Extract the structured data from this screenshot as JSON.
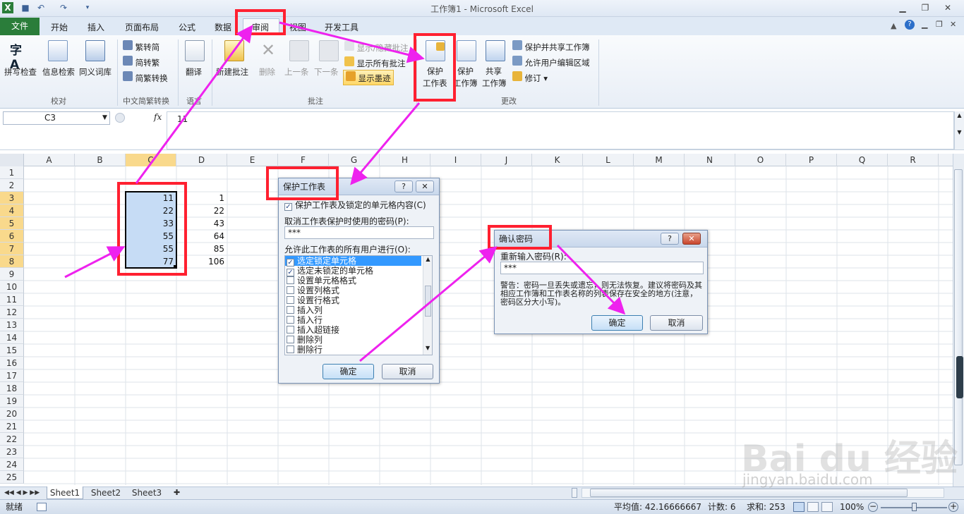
{
  "window": {
    "title": "工作簿1 - Microsoft Excel"
  },
  "tabs": {
    "file": "文件",
    "items": [
      "开始",
      "插入",
      "页面布局",
      "公式",
      "数据",
      "审阅",
      "视图",
      "开发工具"
    ],
    "active": "审阅"
  },
  "ribbon": {
    "proof": {
      "spell": "拼写检查",
      "research": "信息检索",
      "thesaurus": "同义词库",
      "group": "校对"
    },
    "chinese": {
      "t2s": "繁转简",
      "s2t": "简转繁",
      "convert": "简繁转换",
      "group": "中文简繁转换"
    },
    "language": {
      "translate": "翻译",
      "group": "语言"
    },
    "comments": {
      "new": "新建批注",
      "delete": "删除",
      "prev": "上一条",
      "next": "下一条",
      "showhide": "显示/隐藏批注",
      "showall": "显示所有批注",
      "ink": "显示墨迹",
      "group": "批注"
    },
    "changes": {
      "protect_sheet_l1": "保护",
      "protect_sheet_l2": "工作表",
      "protect_wb_l1": "保护",
      "protect_wb_l2": "工作簿",
      "share_l1": "共享",
      "share_l2": "工作簿",
      "protect_share": "保护并共享工作簿",
      "allow_edit": "允许用户编辑区域",
      "track": "修订",
      "group": "更改"
    }
  },
  "formula": {
    "namebox": "C3",
    "fx": "fx",
    "value": "11"
  },
  "columns": [
    "A",
    "B",
    "C",
    "D",
    "E",
    "F",
    "G",
    "H",
    "I",
    "J",
    "K",
    "L",
    "M",
    "N",
    "O",
    "P",
    "Q",
    "R"
  ],
  "rows": [
    "1",
    "2",
    "3",
    "4",
    "5",
    "6",
    "7",
    "8",
    "9",
    "10",
    "11",
    "12",
    "13",
    "14",
    "15",
    "16",
    "17",
    "18",
    "19",
    "20",
    "21",
    "22",
    "23",
    "24",
    "25"
  ],
  "cells": {
    "c": [
      "11",
      "22",
      "33",
      "55",
      "55",
      "77"
    ],
    "d": [
      "1",
      "22",
      "43",
      "64",
      "85",
      "106"
    ]
  },
  "protect_dialog": {
    "title": "保护工作表",
    "protect_check": "保护工作表及锁定的单元格内容(C)",
    "pwd_label": "取消工作表保护时使用的密码(P):",
    "pwd_value": "***",
    "allow_label": "允许此工作表的所有用户进行(O):",
    "options": [
      {
        "label": "选定锁定单元格",
        "checked": true
      },
      {
        "label": "选定未锁定的单元格",
        "checked": true
      },
      {
        "label": "设置单元格格式",
        "checked": false
      },
      {
        "label": "设置列格式",
        "checked": false
      },
      {
        "label": "设置行格式",
        "checked": false
      },
      {
        "label": "插入列",
        "checked": false
      },
      {
        "label": "插入行",
        "checked": false
      },
      {
        "label": "插入超链接",
        "checked": false
      },
      {
        "label": "删除列",
        "checked": false
      },
      {
        "label": "删除行",
        "checked": false
      }
    ],
    "ok": "确定",
    "cancel": "取消"
  },
  "confirm_dialog": {
    "title": "确认密码",
    "reenter_label": "重新输入密码(R):",
    "pwd_value": "***",
    "warning": "警告：密码一旦丢失或遗忘，则无法恢复。建议将密码及其相应工作簿和工作表名称的列表保存在安全的地方(注意，密码区分大小写)。",
    "ok": "确定",
    "cancel": "取消"
  },
  "sheets": [
    "Sheet1",
    "Sheet2",
    "Sheet3"
  ],
  "status": {
    "mode": "就绪",
    "average": "平均值: 42.16666667",
    "count": "计数: 6",
    "sum": "求和: 253",
    "zoom": "100%"
  },
  "watermark": {
    "brand": "Bai du 经验",
    "url": "jingyan.baidu.com"
  },
  "colors": {
    "annotation_red": "#ff2030",
    "arrow_magenta": "#ee22ee",
    "excel_green": "#2a7d3a",
    "selection": "#c6dcf5"
  }
}
